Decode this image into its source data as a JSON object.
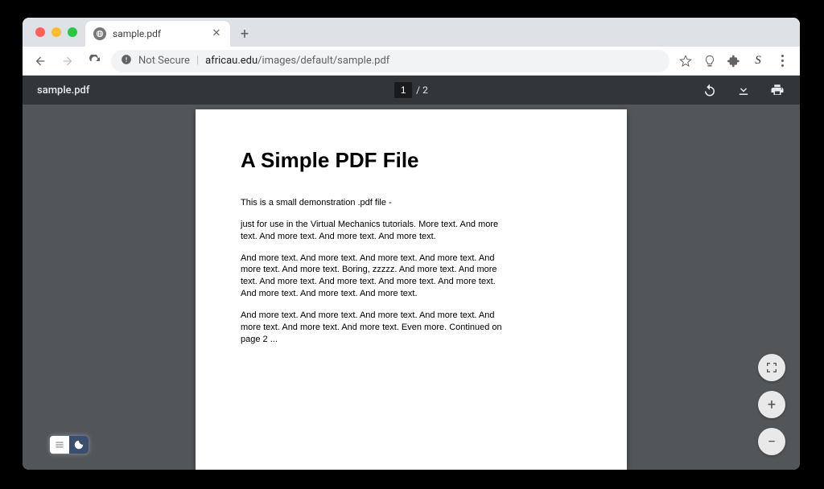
{
  "browser": {
    "tab": {
      "title": "sample.pdf"
    },
    "address": {
      "security_label": "Not Secure",
      "host": "africau.edu",
      "path": "/images/default/sample.pdf"
    }
  },
  "pdf_viewer": {
    "file_name": "sample.pdf",
    "current_page": "1",
    "total_pages_label": "/ 2",
    "actions": {
      "rotate": "Rotate",
      "download": "Download",
      "print": "Print"
    }
  },
  "document": {
    "title": "A Simple PDF File",
    "paragraphs": [
      "This is a small demonstration .pdf file -",
      "just for use in the Virtual Mechanics tutorials. More text. And more text. And more text. And more text. And more text.",
      "And more text. And more text. And more text. And more text. And more text. And more text. Boring, zzzzz. And more text. And more text. And more text. And more text. And more text. And more text. And more text. And more text. And more text.",
      "And more text. And more text. And more text. And more text. And more text. And more text. And more text. Even more. Continued on page 2 ..."
    ]
  },
  "float": {
    "fit": "Fit to page",
    "zoom_in": "+",
    "zoom_out": "−"
  }
}
